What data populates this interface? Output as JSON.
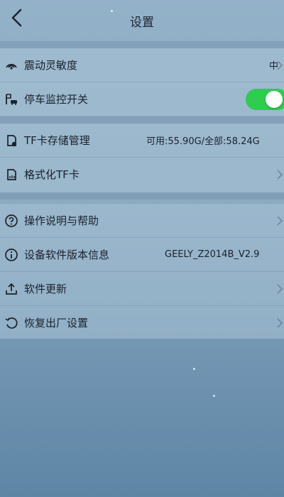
{
  "header": {
    "title": "设置"
  },
  "groups": [
    {
      "items": [
        {
          "label": "震动灵敏度",
          "value": "中",
          "icon": "signal-icon"
        },
        {
          "label": "停车监控开关",
          "toggle_on": true,
          "icon": "parking-monitor-icon"
        }
      ]
    },
    {
      "items": [
        {
          "label": "TF卡存储管理",
          "value": "可用:55.90G/全部:58.24G",
          "icon": "sd-card-icon"
        },
        {
          "label": "格式化TF卡",
          "icon": "format-card-icon"
        }
      ]
    },
    {
      "items": [
        {
          "label": "操作说明与帮助",
          "icon": "help-icon"
        },
        {
          "label": "设备软件版本信息",
          "value": "GEELY_Z2014B_V2.9",
          "icon": "info-icon"
        },
        {
          "label": "软件更新",
          "icon": "upload-icon"
        },
        {
          "label": "恢复出厂设置",
          "icon": "reset-icon"
        }
      ]
    }
  ],
  "colors": {
    "toggle_on": "#2ecc4f",
    "background": "#8aaac2"
  }
}
